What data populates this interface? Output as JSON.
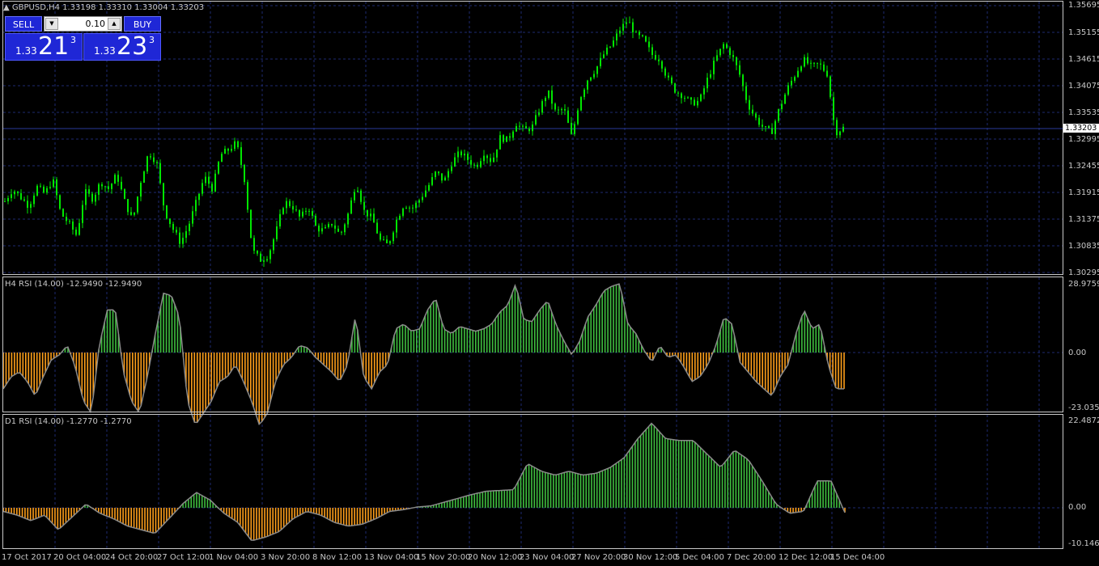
{
  "window": {
    "symbol_title": "GBPUSD,H4  1.33198 1.33310 1.33004 1.33203"
  },
  "trade_panel": {
    "sell_label": "SELL",
    "buy_label": "BUY",
    "lot_value": "0.10",
    "sell_prefix": "1.33",
    "sell_big": "21",
    "sell_sup": "3",
    "buy_prefix": "1.33",
    "buy_big": "23",
    "buy_sup": "3"
  },
  "current_price": "1.33203",
  "price_axis": [
    "1.35695",
    "1.35155",
    "1.34615",
    "1.34075",
    "1.33535",
    "1.32995",
    "1.32455",
    "1.31915",
    "1.31375",
    "1.30835",
    "1.30295"
  ],
  "indicator_h4": {
    "title": "H4 RSI (14.00) -12.9490 -12.9490",
    "axis": [
      "28.9759",
      "0.00",
      "-23.0352"
    ]
  },
  "indicator_d1": {
    "title": "D1 RSI (14.00) -1.2770 -1.2770",
    "axis": [
      "22.4872",
      "0.00",
      "-10.1463"
    ]
  },
  "time_axis": [
    "17 Oct 2017",
    "20 Oct 04:00",
    "24 Oct 20:00",
    "27 Oct 12:00",
    "1 Nov 04:00",
    "3 Nov 20:00",
    "8 Nov 12:00",
    "13 Nov 04:00",
    "15 Nov 20:00",
    "20 Nov 12:00",
    "23 Nov 04:00",
    "27 Nov 20:00",
    "30 Nov 12:00",
    "5 Dec 04:00",
    "7 Dec 20:00",
    "12 Dec 12:00",
    "15 Dec 04:00"
  ],
  "colors": {
    "background": "#000000",
    "candle": "#00e600",
    "grid": "#1e2a70",
    "positive_hist": "#3fbf3f",
    "negative_hist": "#ff9f1a",
    "rsi_line": "#8a8a8a",
    "button": "#1f27d6"
  },
  "chart_data": [
    {
      "type": "candlestick",
      "title": "GBPUSD,H4",
      "ylim": [
        1.30295,
        1.35695
      ],
      "close_path": [
        1.317,
        1.3195,
        1.3178,
        1.316,
        1.32,
        1.3185,
        1.3215,
        1.3145,
        1.3125,
        1.31,
        1.319,
        1.3175,
        1.321,
        1.3195,
        1.3225,
        1.317,
        1.313,
        1.321,
        1.327,
        1.325,
        1.315,
        1.3115,
        1.3085,
        1.312,
        1.317,
        1.322,
        1.3195,
        1.3265,
        1.3275,
        1.329,
        1.3215,
        1.307,
        1.305,
        1.306,
        1.311,
        1.317,
        1.316,
        1.3135,
        1.316,
        1.3115,
        1.311,
        1.3125,
        1.31,
        1.3145,
        1.321,
        1.315,
        1.3135,
        1.309,
        1.308,
        1.313,
        1.3165,
        1.3155,
        1.3175,
        1.32,
        1.323,
        1.321,
        1.325,
        1.327,
        1.3255,
        1.324,
        1.327,
        1.325,
        1.33,
        1.3295,
        1.333,
        1.3315,
        1.332,
        1.336,
        1.3395,
        1.335,
        1.336,
        1.33,
        1.338,
        1.342,
        1.344,
        1.347,
        1.349,
        1.352,
        1.354,
        1.351,
        1.35,
        1.347,
        1.346,
        1.342,
        1.3395,
        1.3385,
        1.337,
        1.3375,
        1.342,
        1.346,
        1.349,
        1.347,
        1.343,
        1.337,
        1.334,
        1.332,
        1.331,
        1.336,
        1.34,
        1.343,
        1.346,
        1.3445,
        1.345,
        1.343,
        1.331,
        1.332
      ],
      "rsi_h4": [
        -15.0,
        -10.0,
        -8.0,
        -12.0,
        -18.0,
        -10.0,
        -3.0,
        -1.0,
        3.0,
        -6.0,
        -20.0,
        -25.0,
        3.0,
        18.0,
        18.0,
        -8.0,
        -20.0,
        -25.0,
        -10.0,
        8.0,
        25.0,
        24.0,
        15.0,
        -20.0,
        -30.0,
        -25.0,
        -20.0,
        -12.0,
        -10.0,
        -5.0,
        -12.0,
        -20.0,
        -30.0,
        -25.0,
        -12.0,
        -5.0,
        -2.0,
        3.0,
        2.0,
        -2.0,
        -5.0,
        -8.0,
        -12.0,
        -5.0,
        16.0,
        -10.0,
        -15.0,
        -8.0,
        -5.0,
        10.0,
        12.0,
        9.0,
        10.0,
        18.0,
        23.0,
        10.0,
        8.0,
        11.0,
        10.0,
        9.0,
        10.0,
        12.0,
        17.0,
        20.0,
        29.0,
        14.0,
        13.0,
        18.0,
        22.0,
        12.0,
        5.0,
        -1.0,
        5.0,
        15.0,
        20.0,
        26.0,
        28.0,
        29.0,
        12.0,
        8.0,
        1.0,
        -4.0,
        3.0,
        -2.0,
        -1.0,
        -6.0,
        -12.0,
        -10.0,
        -5.0,
        3.0,
        15.0,
        12.0,
        -4.0,
        -8.0,
        -12.0,
        -15.0,
        -18.0,
        -10.0,
        -5.0,
        8.0,
        18.0,
        10.0,
        12.0,
        -5.0,
        -15.0,
        -15.0
      ],
      "rsi_d1": [
        -1.0,
        -2.0,
        -3.5,
        -2.0,
        -6.0,
        -2.5,
        1.0,
        -1.5,
        -3.0,
        -5.0,
        -6.0,
        -7.0,
        -3.0,
        1.0,
        4.0,
        2.0,
        -1.5,
        -4.0,
        -9.0,
        -8.0,
        -6.5,
        -3.0,
        -1.0,
        -2.0,
        -4.0,
        -5.0,
        -4.5,
        -3.0,
        -1.0,
        -0.5,
        0.2,
        0.5,
        1.5,
        2.5,
        3.5,
        4.3,
        4.5,
        4.7,
        11.5,
        9.5,
        8.5,
        9.5,
        8.5,
        9.0,
        10.5,
        13.0,
        18.0,
        22.0,
        18.0,
        17.5,
        17.5,
        14.0,
        10.5,
        15.0,
        12.5,
        7.0,
        1.0,
        -1.5,
        -1.0,
        7.0,
        7.0,
        -1.3
      ]
    }
  ]
}
